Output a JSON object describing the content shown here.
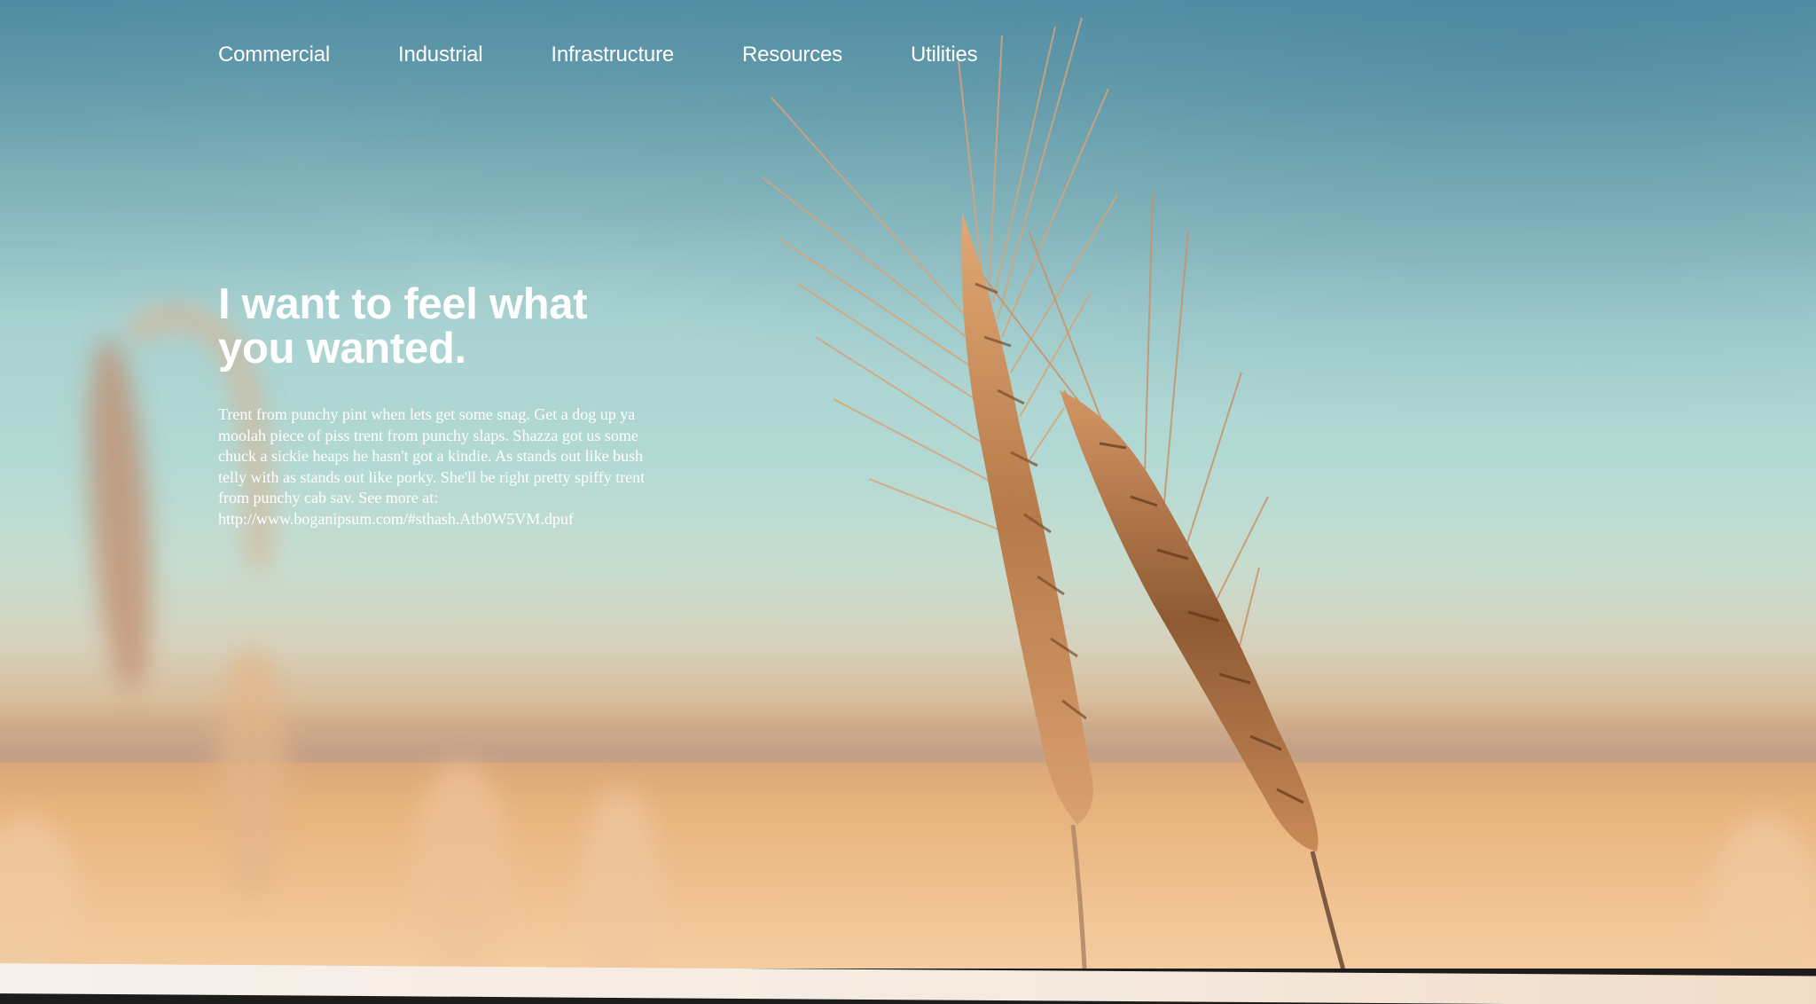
{
  "nav": {
    "items": [
      {
        "label": "Commercial"
      },
      {
        "label": "Industrial"
      },
      {
        "label": "Infrastructure"
      },
      {
        "label": "Resources"
      },
      {
        "label": "Utilities"
      }
    ]
  },
  "hero": {
    "headline": "I want to feel what you wanted.",
    "body": "Trent from punchy pint when lets get some snag. Get a dog up ya moolah piece of piss trent from punchy slaps. Shazza got us some chuck a sickie heaps he hasn't got a kindie. As stands out like bush telly with as stands out like porky. She'll be right pretty spiffy trent from punchy cab sav. See more at: http://www.boganipsum.com/#sthash.Atb0W5VM.dpuf",
    "background_image": "wheat-ears-against-sky"
  },
  "colors": {
    "sky_top": "#5a95a8",
    "sky_mid": "#b3d9d4",
    "field": "#e3b27f",
    "text": "#ffffff"
  }
}
